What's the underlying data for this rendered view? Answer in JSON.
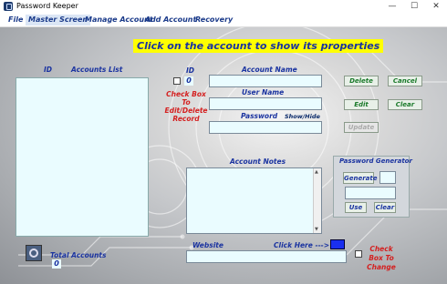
{
  "window": {
    "title": "Password Keeper",
    "controls": {
      "minimize": "—",
      "maximize": "☐",
      "close": "✕"
    }
  },
  "menu": [
    "File",
    "Master Screen",
    "Manage Account",
    "Add Account",
    "Recovery"
  ],
  "banner": "Click on the account to show its properties",
  "accounts_list": {
    "id_label": "ID",
    "header": "Accounts List"
  },
  "id_field": {
    "label": "ID",
    "value": "0"
  },
  "account_name": {
    "label": "Account Name",
    "value": ""
  },
  "user_name": {
    "label": "User Name",
    "value": ""
  },
  "password": {
    "label": "Password",
    "toggle": "Show/Hide",
    "value": ""
  },
  "record_checkbox_label": "Check Box To Edit/Delete Record",
  "buttons": {
    "delete": "Delete",
    "cancel": "Cancel",
    "edit": "Edit",
    "clear": "Clear",
    "update": "Update"
  },
  "account_notes": {
    "label": "Account Notes",
    "value": ""
  },
  "password_generator": {
    "title": "Password Generator",
    "generate": "Generate",
    "use": "Use",
    "clear": "Clear",
    "output": ""
  },
  "total_accounts": {
    "label": "Total Accounts",
    "value": "0"
  },
  "website": {
    "label": "Website",
    "link_text": "Click Here  --->",
    "value": ""
  },
  "change_checkbox_label": "Check Box To Change",
  "colors": {
    "menu_text": "#1a3a8a",
    "label_blue": "#1a33a0",
    "label_red": "#d42020",
    "banner_bg": "#ffff00",
    "button_green": "#1a7a2a",
    "field_bg": "#eafcff"
  }
}
